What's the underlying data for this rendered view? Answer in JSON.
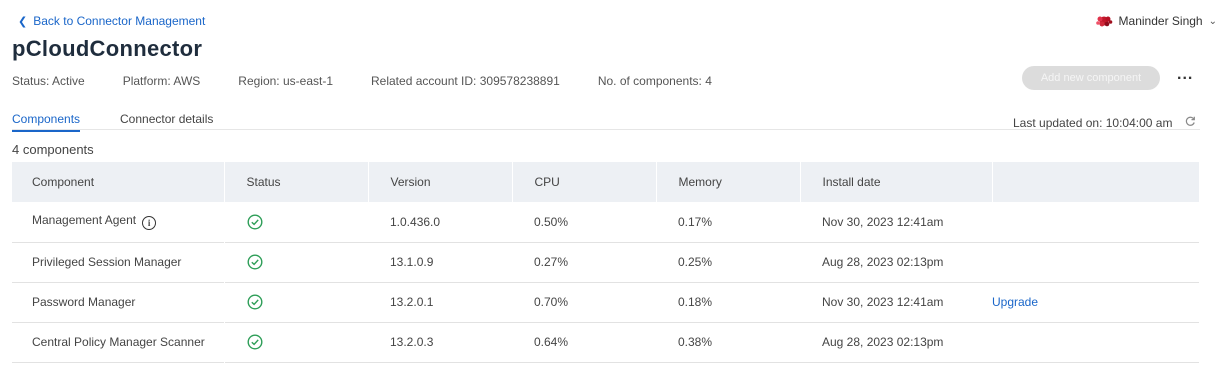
{
  "nav": {
    "back_label": "Back to Connector Management"
  },
  "user": {
    "name": "Maninder Singh"
  },
  "page": {
    "title": "pCloudConnector"
  },
  "meta": {
    "status": "Status: Active",
    "platform": "Platform: AWS",
    "region": "Region: us-east-1",
    "account": "Related account ID: 309578238891",
    "components": "No. of components: 4"
  },
  "actions": {
    "add_label": "Add new component",
    "more_label": "..."
  },
  "tabs": [
    {
      "label": "Components"
    },
    {
      "label": "Connector details"
    }
  ],
  "updated": {
    "text": "Last updated on: 10:04:00 am"
  },
  "table": {
    "count_label": "4 components",
    "headers": [
      "Component",
      "Status",
      "Version",
      "CPU",
      "Memory",
      "Install date"
    ],
    "rows": [
      {
        "component": "Management Agent",
        "version": "1.0.436.0",
        "cpu": "0.50%",
        "memory": "0.17%",
        "install_date": "Nov 30, 2023 12:41am",
        "action": ""
      },
      {
        "component": "Privileged Session Manager",
        "version": "13.1.0.9",
        "cpu": "0.27%",
        "memory": "0.25%",
        "install_date": "Aug 28, 2023 02:13pm",
        "action": ""
      },
      {
        "component": "Password Manager",
        "version": "13.2.0.1",
        "cpu": "0.70%",
        "memory": "0.18%",
        "install_date": "Nov 30, 2023 12:41am",
        "action": "Upgrade"
      },
      {
        "component": "Central Policy Manager Scanner",
        "version": "13.2.0.3",
        "cpu": "0.64%",
        "memory": "0.38%",
        "install_date": "Aug 28, 2023 02:13pm",
        "action": ""
      }
    ]
  },
  "colors": {
    "accent": "#1a66c9",
    "success": "#2e9e58",
    "header_bg": "#edf0f4",
    "disabled_btn": "#dcdcdc"
  },
  "icons": {
    "back": "chevron-left-icon",
    "user_caret": "chevron-down-icon",
    "refresh": "refresh-icon",
    "status": "check-circle-icon",
    "info": "info-icon"
  }
}
